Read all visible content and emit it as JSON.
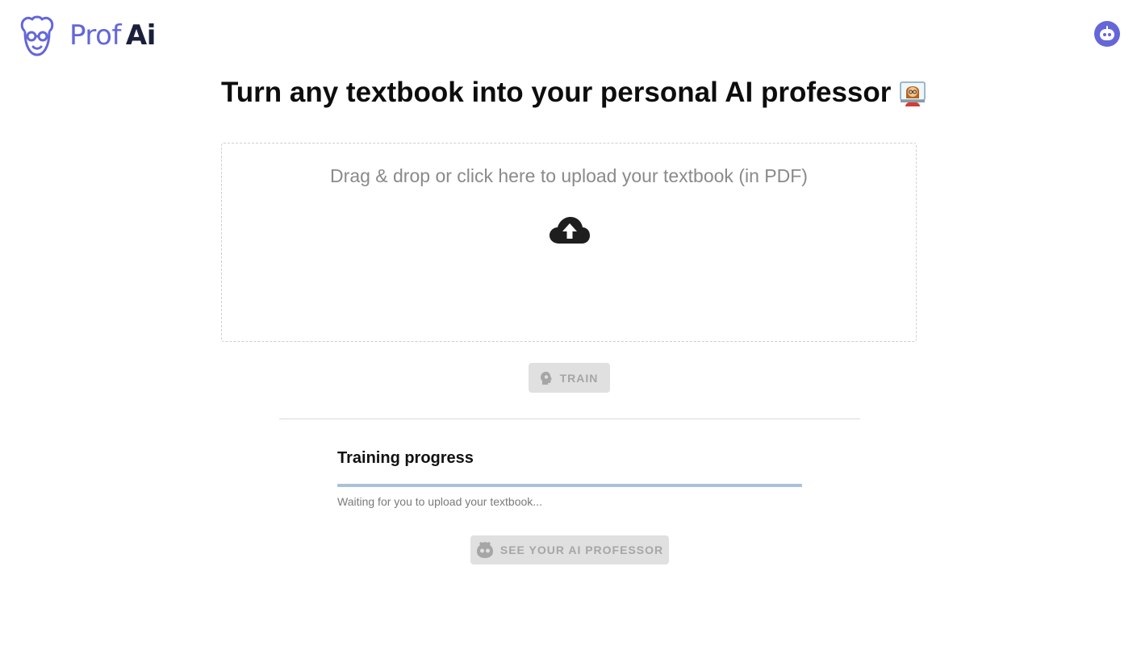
{
  "header": {
    "logo": {
      "brand_part1": "Prof",
      "brand_part2": "Ai",
      "mark_icon": "professor-face-icon"
    },
    "avatar_icon": "robot-face-icon",
    "colors": {
      "brand": "#6466d9",
      "brand_dark": "#1b1f3b"
    }
  },
  "main": {
    "title": "Turn any textbook into your personal AI professor",
    "title_icon": "woman-teacher-emoji",
    "dropzone": {
      "text": "Drag & drop or click here to upload your textbook (in PDF)",
      "icon": "cloud-upload-icon"
    },
    "train_button": {
      "label": "TRAIN",
      "icon": "brain-head-icon",
      "state": "disabled"
    },
    "progress": {
      "heading": "Training progress",
      "value": 0,
      "status": "Waiting for you to upload your textbook..."
    },
    "see_professor_button": {
      "label": "SEE YOUR AI PROFESSOR",
      "icon": "robot-face-icon",
      "state": "disabled"
    }
  }
}
